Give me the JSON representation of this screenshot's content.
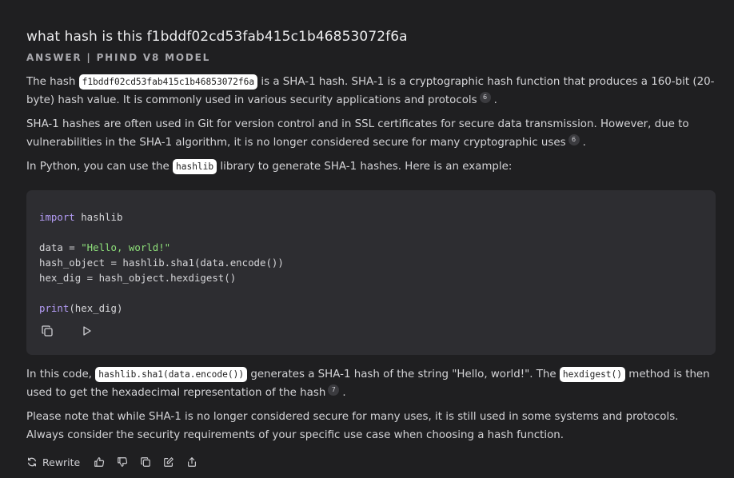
{
  "question": "what hash is this f1bddf02cd53fab415c1b46853072f6a",
  "answer_label": "ANSWER | PHIND V8 MODEL",
  "p1": {
    "t1": "The hash ",
    "code": "f1bddf02cd53fab415c1b46853072f6a",
    "t2": " is a SHA-1 hash. SHA-1 is a cryptographic hash function that produces a 160-bit (20-byte) hash value. It is commonly used in various security applications and protocols",
    "cite": "6",
    "t3": "."
  },
  "p2": {
    "t1": "SHA-1 hashes are often used in Git for version control and in SSL certificates for secure data transmission. However, due to vulnerabilities in the SHA-1 algorithm, it is no longer considered secure for many cryptographic uses",
    "cite": "6",
    "t2": "."
  },
  "p3": {
    "t1": "In Python, you can use the ",
    "code": "hashlib",
    "t2": " library to generate SHA-1 hashes. Here is an example:"
  },
  "code": {
    "line1_kw": "import",
    "line1_rest": " hashlib",
    "line3_a": "data = ",
    "line3_str": "\"Hello, world!\"",
    "line4": "hash_object = hashlib.sha1(data.encode())",
    "line5": "hex_dig = hash_object.hexdigest()",
    "line7_kw": "print",
    "line7_rest": "(hex_dig)"
  },
  "p4": {
    "t1": "In this code, ",
    "code1": "hashlib.sha1(data.encode())",
    "t2": " generates a SHA-1 hash of the string \"Hello, world!\". The ",
    "code2": "hexdigest()",
    "t3": " method is then used to get the hexadecimal representation of the hash",
    "cite": "7",
    "t4": "."
  },
  "p5": {
    "t1": "Please note that while SHA-1 is no longer considered secure for many uses, it is still used in some systems and protocols. Always consider the security requirements of your specific use case when choosing a hash function."
  },
  "footer": {
    "rewrite_label": "Rewrite"
  },
  "icons": [
    "copy-icon",
    "play-icon",
    "refresh-icon",
    "thumbs-up-icon",
    "thumbs-down-icon",
    "copy-icon",
    "edit-icon",
    "share-icon"
  ]
}
